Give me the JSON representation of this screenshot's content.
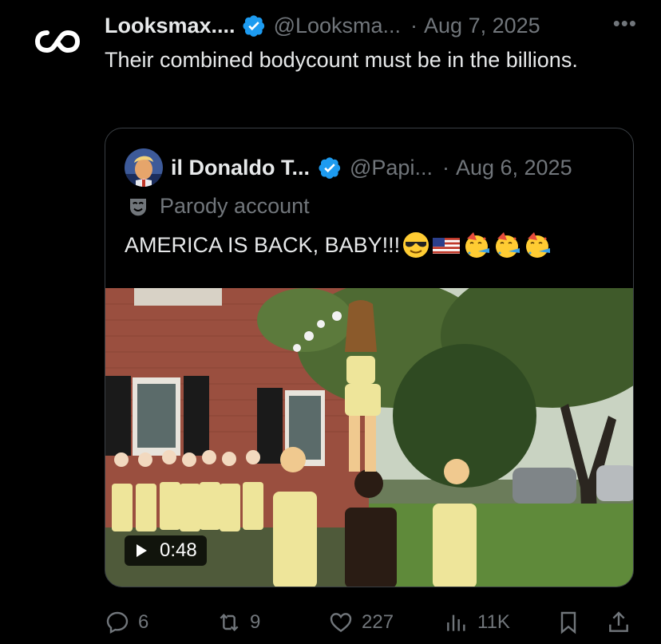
{
  "post": {
    "author_name": "Looksmax....",
    "author_handle": "@Looksma...",
    "separator": "·",
    "date": "Aug 7, 2025",
    "more": "•••",
    "text": "Their combined bodycount must be in the billions."
  },
  "quote": {
    "author_name": "il Donaldo T...",
    "author_handle": "@Papi...",
    "separator": "·",
    "date": "Aug 6, 2025",
    "label": "Parody account",
    "text": "AMERICA IS BACK, BABY!!!",
    "emojis": [
      "sunglasses-face-icon",
      "us-flag-icon",
      "party-face-icon",
      "party-face-icon",
      "party-face-icon"
    ],
    "video_duration": "0:48"
  },
  "actions": {
    "replies": "6",
    "reposts": "9",
    "likes": "227",
    "views": "11K"
  },
  "colors": {
    "background": "#000000",
    "text": "#e7e9ea",
    "muted": "#71767b",
    "verified": "#1d9bf0",
    "border": "#3a3f44"
  }
}
